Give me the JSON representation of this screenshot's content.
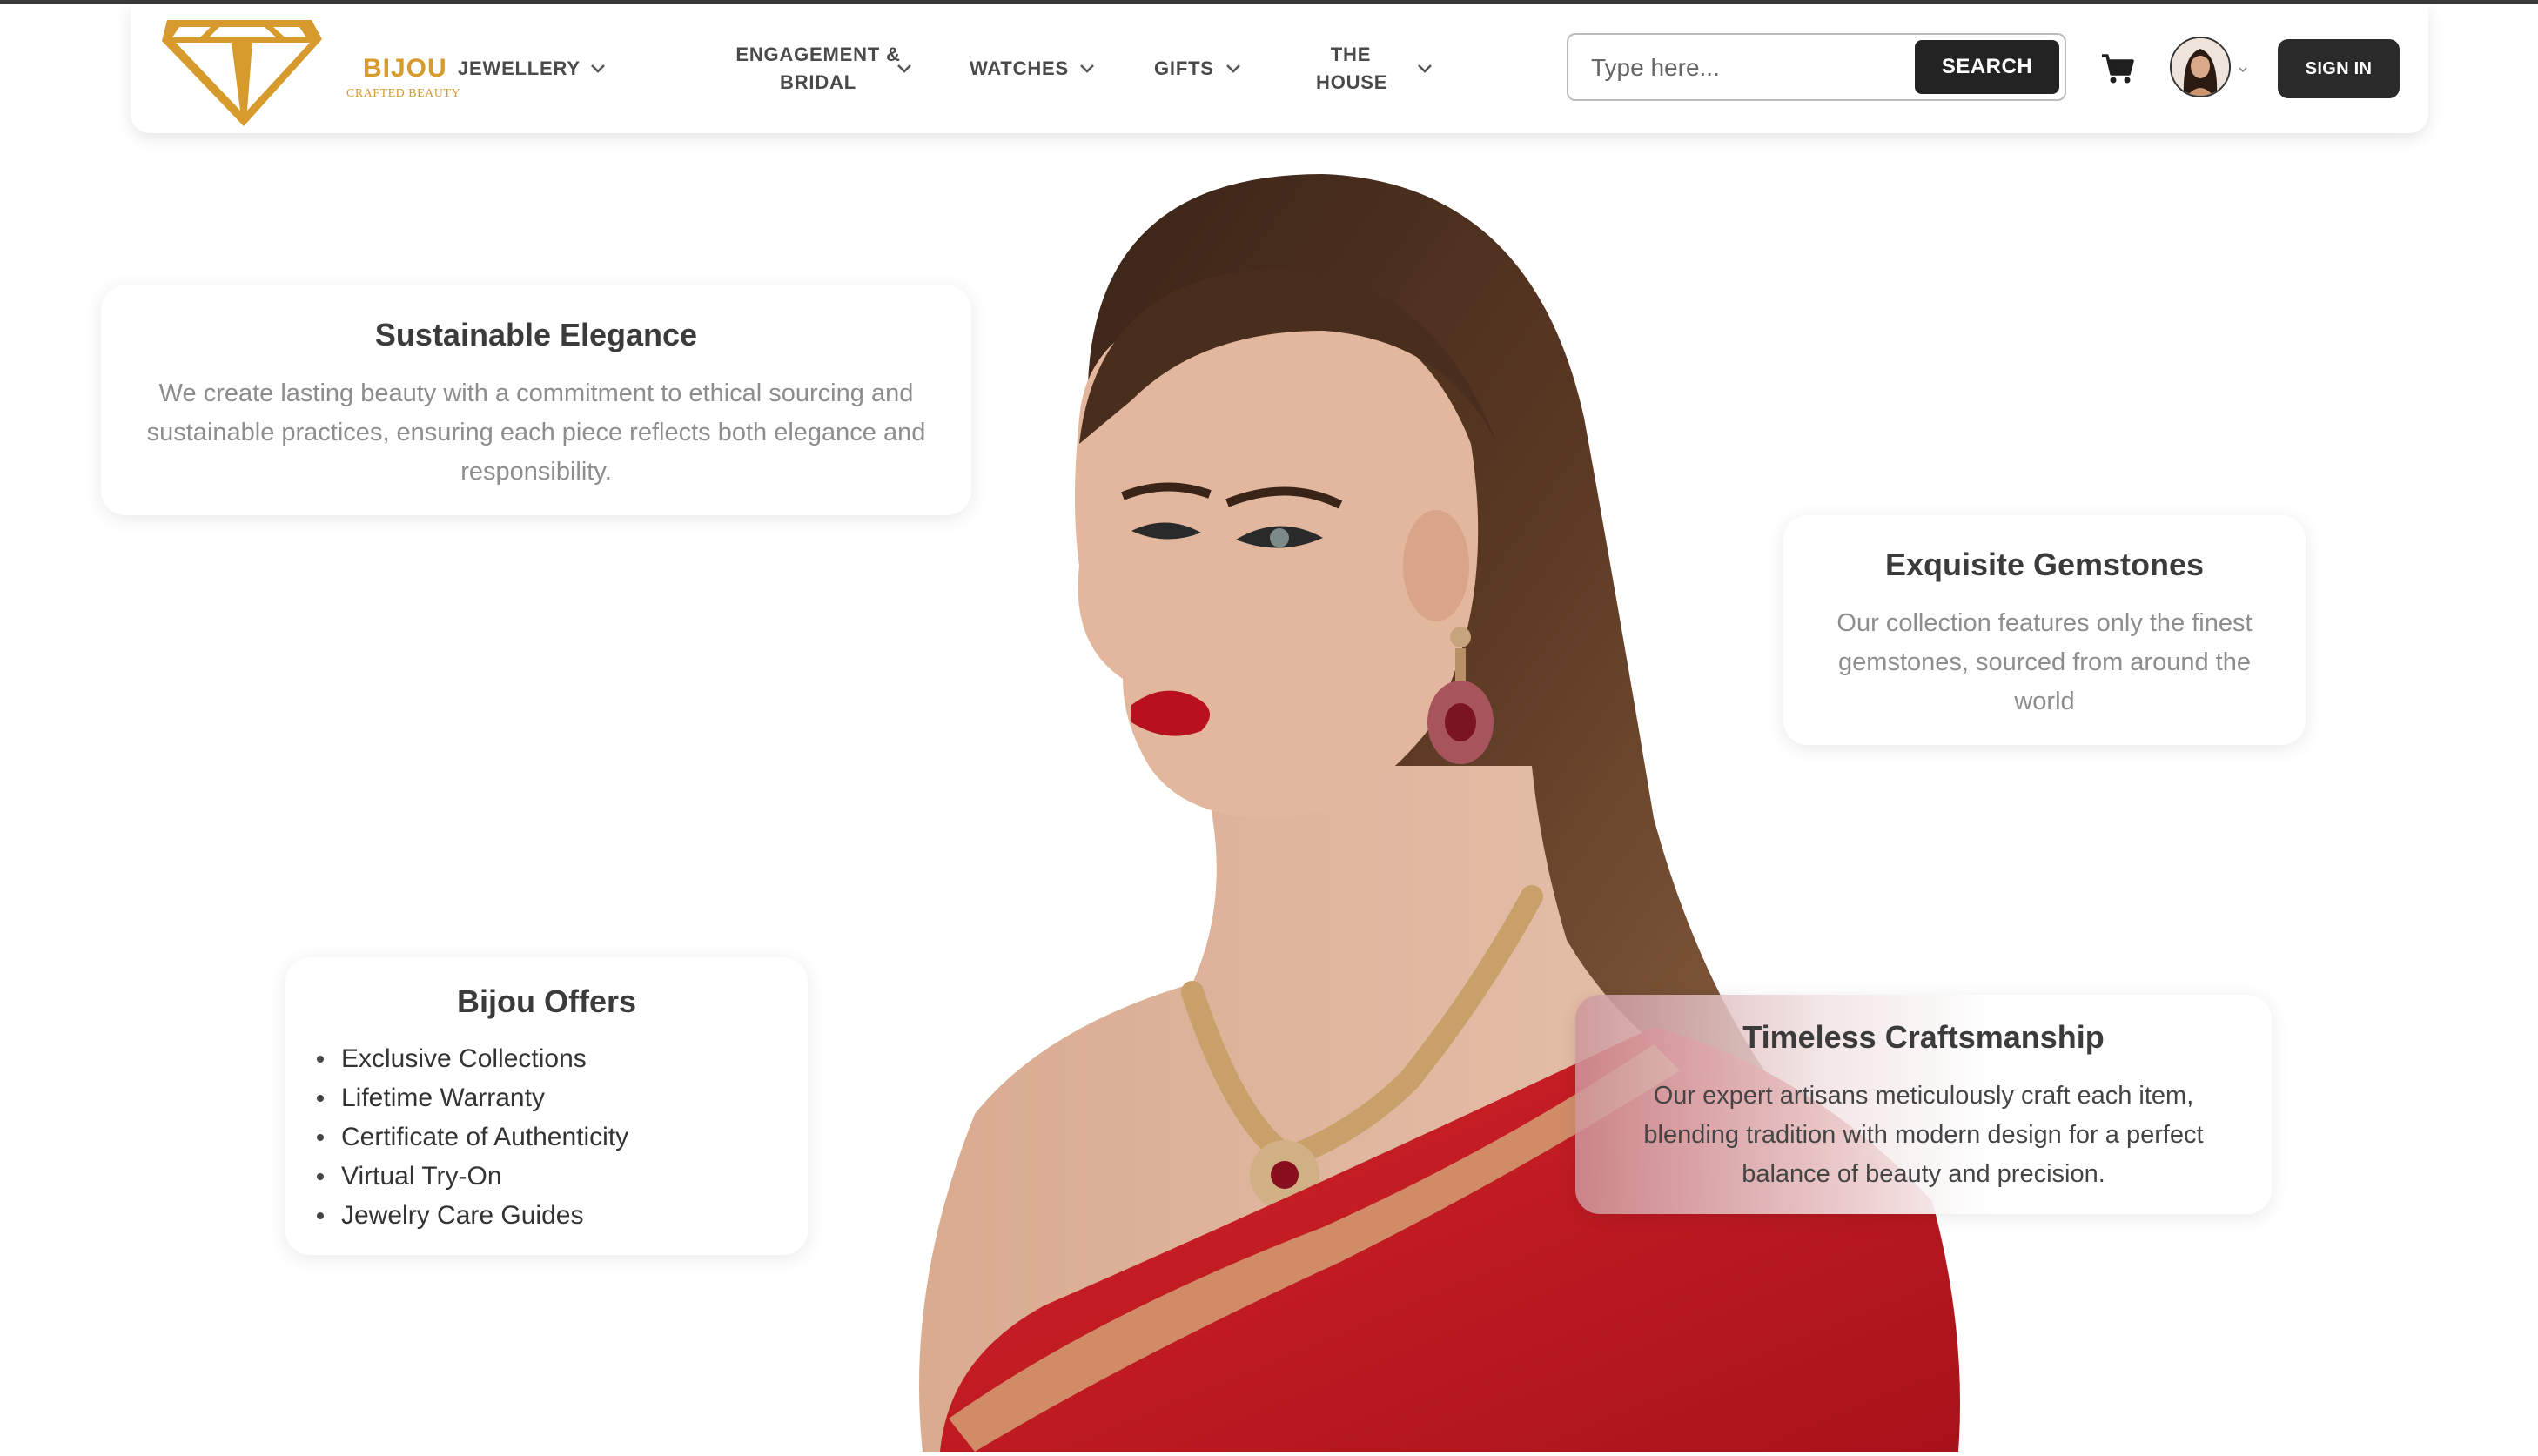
{
  "brand": {
    "name": "BIJOU",
    "tagline": "CRAFTED BEAUTY",
    "color": "#d79a2c"
  },
  "nav": {
    "items": [
      {
        "label": "JEWELLERY"
      },
      {
        "label": "ENGAGEMENT & BRIDAL"
      },
      {
        "label": "WATCHES"
      },
      {
        "label": "GIFTS"
      },
      {
        "label": "THE HOUSE"
      }
    ]
  },
  "search": {
    "placeholder": "Type here...",
    "button_label": "SEARCH"
  },
  "header_actions": {
    "cart_icon": "cart-icon",
    "signin_label": "SIGN IN"
  },
  "cards": {
    "sustainable": {
      "title": "Sustainable Elegance",
      "text": "We create lasting beauty with a commitment to ethical sourcing and sustainable practices, ensuring each piece reflects both elegance and responsibility."
    },
    "gemstones": {
      "title": "Exquisite Gemstones",
      "text": "Our collection features only the finest gemstones, sourced from around the world"
    },
    "offers": {
      "title": "Bijou Offers",
      "items": [
        "Exclusive Collections",
        "Lifetime Warranty",
        "Certificate of Authenticity",
        "Virtual Try-On",
        "Jewelry Care Guides"
      ]
    },
    "craftsmanship": {
      "title": "Timeless Craftsmanship",
      "text": "Our expert artisans meticulously craft each item, blending tradition with modern design for a perfect balance of beauty and precision."
    }
  },
  "colors": {
    "accent_gold": "#d79a2c",
    "dark_button": "#232323",
    "saree_red": "#c8191f"
  }
}
